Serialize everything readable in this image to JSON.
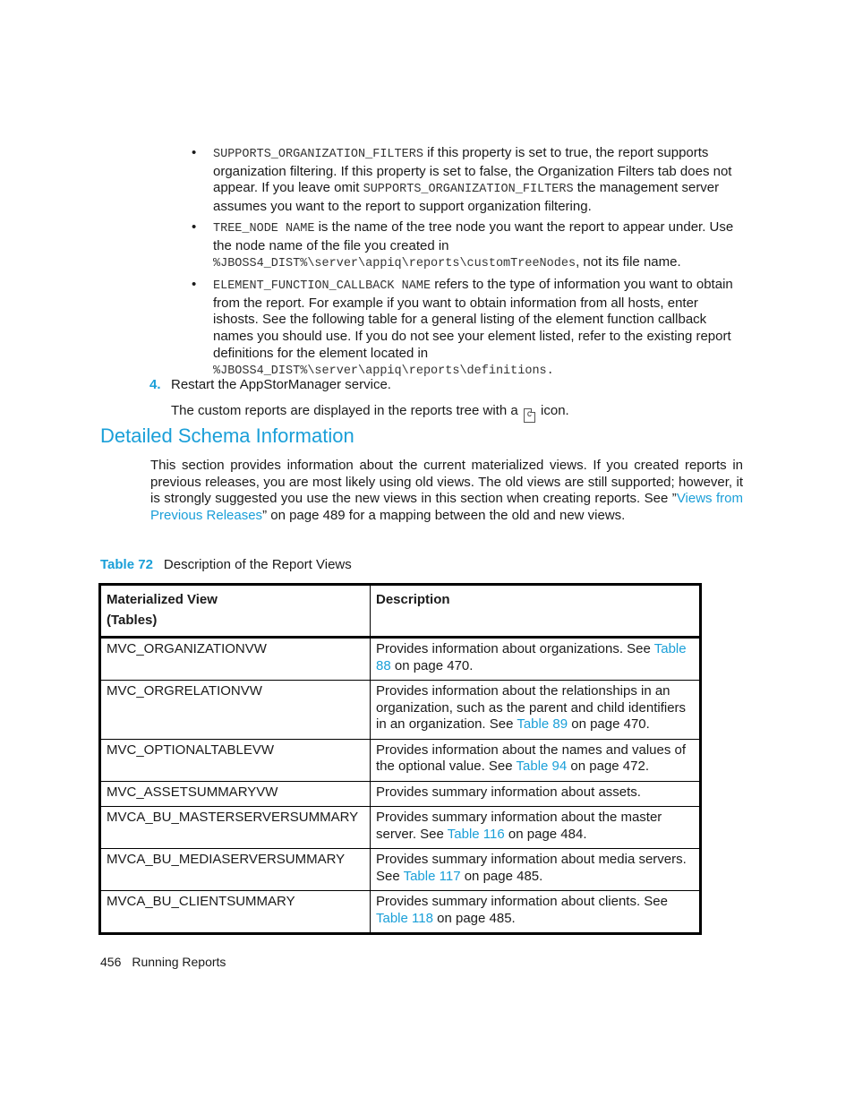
{
  "bullets": [
    {
      "code": "SUPPORTS_ORGANIZATION_FILTERS",
      "text1": " if this property is set to true, the report supports organization filtering. If this property is set to false, the Organization Filters tab does not appear. If you leave omit ",
      "code2": "SUPPORTS_ORGANIZATION_FILTERS",
      "text2": "  the management server assumes you want to the report to support organization filtering."
    },
    {
      "code": "TREE_NODE NAME",
      "text1": " is the name of the tree node you want the report to appear under. Use the node name of the file you created in ",
      "code2": "%JBOSS4_DIST%\\server\\appiq\\reports\\customTreeNodes",
      "text2": ", not its file name."
    },
    {
      "code": "ELEMENT_FUNCTION_CALLBACK NAME",
      "text1": " refers to the type of information you want to obtain from the report. For example if you want to obtain information from all hosts, enter ishosts. See the following table for a general listing of the element function callback names you should use. If you do not see your element listed, refer to the existing report definitions for the element located in ",
      "code2": "%JBOSS4_DIST%\\server\\appiq\\reports\\definitions.",
      "text2": ""
    }
  ],
  "step": {
    "number": "4.",
    "text": "Restart the AppStorManager service."
  },
  "note": {
    "before": "The custom reports are displayed in the reports tree with a ",
    "icon": "custom-report-icon",
    "icon_glyph": "c",
    "after": " icon."
  },
  "section": {
    "title": "Detailed Schema Information",
    "intro_before": "This section provides information about the current materialized views. If you created reports in previous releases, you are most likely using old views. The old views are still supported; however, it is strongly suggested you use the new views in this section when creating reports. See ”",
    "intro_link": "Views from Previous Releases",
    "intro_after": "” on page 489 for a mapping between the old and new views."
  },
  "table": {
    "caption_label": "Table 72",
    "caption_text": "Description of the Report Views",
    "headers": [
      "Materialized View (Tables)",
      "Description"
    ],
    "header_line1": "Materialized View",
    "header_line2": "(Tables)",
    "rows": [
      {
        "view": "MVC_ORGANIZATIONVW",
        "desc": "Provides information about organizations. See ",
        "link": "Table 88",
        "after": " on page 470."
      },
      {
        "view": "MVC_ORGRELATIONVW",
        "desc": "Provides information about the relationships in an organization, such as the parent and child identifiers in an organization. See ",
        "link": "Table 89",
        "after": " on page 470."
      },
      {
        "view": "MVC_OPTIONALTABLEVW",
        "desc": "Provides information about the names and values of the optional value. See ",
        "link": "Table 94",
        "after": " on page 472."
      },
      {
        "view": "MVC_ASSETSUMMARYVW",
        "desc": "Provides summary information about assets.",
        "link": "",
        "after": ""
      },
      {
        "view": "MVCA_BU_MASTERSERVERSUMMARY",
        "desc": "Provides summary information about the master server. See ",
        "link": "Table 116",
        "after": " on page 484."
      },
      {
        "view": "MVCA_BU_MEDIASERVERSUMMARY",
        "desc": "Provides summary information about media servers. See ",
        "link": "Table 117",
        "after": " on page 485."
      },
      {
        "view": "MVCA_BU_CLIENTSUMMARY",
        "desc": "Provides summary information about clients. See ",
        "link": "Table 118",
        "after": " on page 485."
      }
    ]
  },
  "footer": {
    "page_number": "456",
    "chapter": "Running Reports"
  },
  "colors": {
    "accent": "#1a9fd8",
    "text": "#1a1a1a"
  }
}
